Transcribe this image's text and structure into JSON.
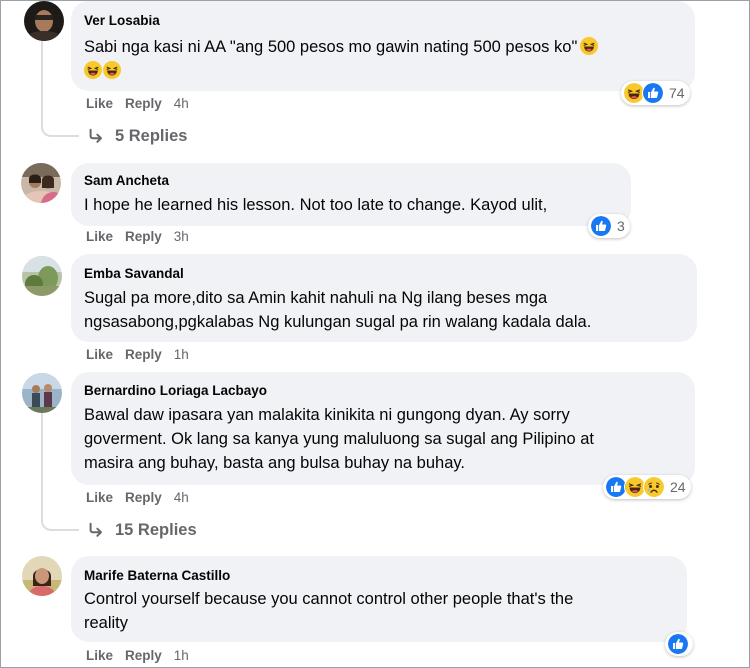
{
  "comments": [
    {
      "author": "Ver Losabia",
      "text_line1": "Sabi nga kasi ni AA \"ang 500 pesos mo gawin nating 500 pesos ko\"",
      "like": "Like",
      "reply": "Reply",
      "time": "4h",
      "reactions": [
        "haha-icon",
        "like-icon"
      ],
      "reaction_count": "74",
      "replies_label": "5 Replies"
    },
    {
      "author": "Sam Ancheta",
      "text": "I hope he learned his lesson. Not too late to change. Kayod ulit,",
      "like": "Like",
      "reply": "Reply",
      "time": "3h",
      "reactions": [
        "like-icon"
      ],
      "reaction_count": "3"
    },
    {
      "author": "Emba Savandal",
      "text_lines": [
        "Sugal pa more,dito sa Amin kahit nahuli na Ng ilang beses mga",
        "ngsasabong,pgkalabas Ng kulungan sugal pa rin walang kadala dala."
      ],
      "like": "Like",
      "reply": "Reply",
      "time": "1h"
    },
    {
      "author": "Bernardino Loriaga Lacbayo",
      "text_lines": [
        "Bawal daw ipasara yan malakita kinikita ni gungong dyan. Ay sorry",
        "goverment. Ok lang sa kanya yung maluluong sa sugal ang Pilipino at",
        "masira ang buhay, basta ang bulsa buhay na buhay."
      ],
      "like": "Like",
      "reply": "Reply",
      "time": "4h",
      "reactions": [
        "like-icon",
        "haha-icon",
        "sad-icon"
      ],
      "reaction_count": "24",
      "replies_label": "15 Replies"
    },
    {
      "author": "Marife Baterna Castillo",
      "text_lines": [
        "Control yourself because you cannot control other people that's the",
        "reality"
      ],
      "like": "Like",
      "reply": "Reply",
      "time": "1h",
      "reactions": [
        "like-icon"
      ]
    }
  ],
  "colors": {
    "bubble": "#f0f2f5",
    "muted": "#65676b",
    "like_blue": "#1877f2",
    "haha_yellow": "#f7c92c"
  }
}
